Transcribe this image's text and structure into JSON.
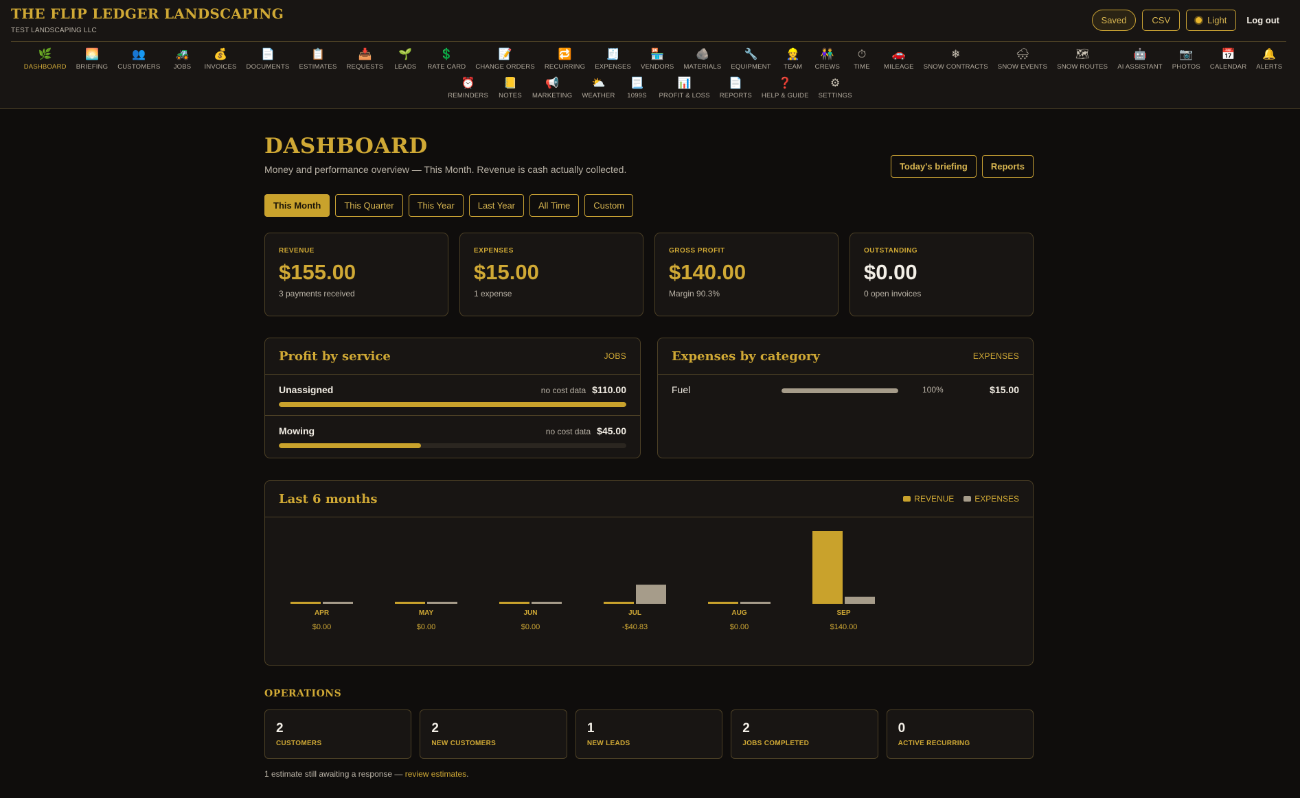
{
  "header": {
    "title": "THE FLIP LEDGER LANDSCAPING",
    "subtitle": "TEST LANDSCAPING LLC",
    "saved_label": "Saved",
    "csv_label": "CSV",
    "theme_label": "Light",
    "logout_label": "Log out"
  },
  "nav": {
    "row1": [
      {
        "label": "DASHBOARD",
        "icon": "🌿",
        "name": "dashboard"
      },
      {
        "label": "BRIEFING",
        "icon": "🌅",
        "name": "briefing"
      },
      {
        "label": "CUSTOMERS",
        "icon": "👥",
        "name": "customers"
      },
      {
        "label": "JOBS",
        "icon": "🚜",
        "name": "jobs"
      },
      {
        "label": "INVOICES",
        "icon": "💰",
        "name": "invoices"
      },
      {
        "label": "DOCUMENTS",
        "icon": "📄",
        "name": "documents"
      },
      {
        "label": "ESTIMATES",
        "icon": "📋",
        "name": "estimates"
      },
      {
        "label": "REQUESTS",
        "icon": "📥",
        "name": "requests"
      },
      {
        "label": "LEADS",
        "icon": "🌱",
        "name": "leads"
      },
      {
        "label": "RATE CARD",
        "icon": "💲",
        "name": "rate-card"
      },
      {
        "label": "CHANGE ORDERS",
        "icon": "📝",
        "name": "change-orders"
      },
      {
        "label": "RECURRING",
        "icon": "🔁",
        "name": "recurring"
      },
      {
        "label": "EXPENSES",
        "icon": "🧾",
        "name": "expenses"
      },
      {
        "label": "VENDORS",
        "icon": "🏪",
        "name": "vendors"
      },
      {
        "label": "MATERIALS",
        "icon": "🪨",
        "name": "materials"
      },
      {
        "label": "EQUIPMENT",
        "icon": "🔧",
        "name": "equipment"
      },
      {
        "label": "TEAM",
        "icon": "👷",
        "name": "team"
      },
      {
        "label": "CREWS",
        "icon": "👫",
        "name": "crews"
      },
      {
        "label": "TIME",
        "icon": "⏱",
        "name": "time"
      },
      {
        "label": "MILEAGE",
        "icon": "🚗",
        "name": "mileage"
      },
      {
        "label": "SNOW CONTRACTS",
        "icon": "❄",
        "name": "snow-contracts"
      },
      {
        "label": "SNOW EVENTS",
        "icon": "🌨",
        "name": "snow-events"
      },
      {
        "label": "SNOW ROUTES",
        "icon": "🗺",
        "name": "snow-routes"
      },
      {
        "label": "AI ASSISTANT",
        "icon": "🤖",
        "name": "ai-assistant"
      },
      {
        "label": "PHOTOS",
        "icon": "📷",
        "name": "photos"
      },
      {
        "label": "CALENDAR",
        "icon": "📅",
        "name": "calendar"
      },
      {
        "label": "ALERTS",
        "icon": "🔔",
        "name": "alerts"
      }
    ],
    "row2": [
      {
        "label": "REMINDERS",
        "icon": "⏰",
        "name": "reminders"
      },
      {
        "label": "NOTES",
        "icon": "📒",
        "name": "notes"
      },
      {
        "label": "MARKETING",
        "icon": "📢",
        "name": "marketing"
      },
      {
        "label": "WEATHER",
        "icon": "⛅",
        "name": "weather"
      },
      {
        "label": "1099S",
        "icon": "📃",
        "name": "1099s"
      },
      {
        "label": "PROFIT & LOSS",
        "icon": "📊",
        "name": "profit-loss"
      },
      {
        "label": "REPORTS",
        "icon": "📄",
        "name": "reports"
      },
      {
        "label": "HELP & GUIDE",
        "icon": "❓",
        "name": "help-guide"
      },
      {
        "label": "SETTINGS",
        "icon": "⚙",
        "name": "settings"
      }
    ]
  },
  "page": {
    "title": "DASHBOARD",
    "subtitle": "Money and performance overview — This Month. Revenue is cash actually collected.",
    "briefing_label": "Today's briefing",
    "reports_label": "Reports"
  },
  "periods": [
    "This Month",
    "This Quarter",
    "This Year",
    "Last Year",
    "All Time",
    "Custom"
  ],
  "active_period": 0,
  "kpis": [
    {
      "label": "REVENUE",
      "value": "$155.00",
      "sub": "3 payments received"
    },
    {
      "label": "EXPENSES",
      "value": "$15.00",
      "sub": "1 expense"
    },
    {
      "label": "GROSS PROFIT",
      "value": "$140.00",
      "sub": "Margin 90.3%"
    },
    {
      "label": "OUTSTANDING",
      "value": "$0.00",
      "sub": "0 open invoices"
    }
  ],
  "profit_by_service": {
    "title": "Profit by service",
    "tag": "JOBS",
    "rows": [
      {
        "name": "Unassigned",
        "note": "no cost data",
        "amount": "$110.00",
        "fraction": 1.0
      },
      {
        "name": "Mowing",
        "note": "no cost data",
        "amount": "$45.00",
        "fraction": 0.41
      }
    ]
  },
  "expenses_by_category": {
    "title": "Expenses by category",
    "tag": "EXPENSES",
    "rows": [
      {
        "name": "Fuel",
        "pct": "100%",
        "amount": "$15.00",
        "fraction": 1.0
      }
    ]
  },
  "chart_data": {
    "type": "bar",
    "title": "Last 6 months",
    "categories": [
      "APR",
      "MAY",
      "JUN",
      "JUL",
      "AUG",
      "SEP"
    ],
    "series": [
      {
        "name": "REVENUE",
        "color": "#c9a22c",
        "values": [
          0,
          0,
          0,
          0,
          0,
          155
        ]
      },
      {
        "name": "EXPENSES",
        "color": "#a69c8a",
        "values": [
          0,
          0,
          0,
          40.83,
          0,
          15
        ]
      }
    ],
    "net_labels": [
      "$0.00",
      "$0.00",
      "$0.00",
      "-$40.83",
      "$0.00",
      "$140.00"
    ],
    "ylim": [
      0,
      155
    ],
    "grid": false,
    "legend": "top-right"
  },
  "operations": {
    "title": "OPERATIONS",
    "items": [
      {
        "value": "2",
        "label": "CUSTOMERS"
      },
      {
        "value": "2",
        "label": "NEW CUSTOMERS"
      },
      {
        "value": "1",
        "label": "NEW LEADS"
      },
      {
        "value": "2",
        "label": "JOBS COMPLETED"
      },
      {
        "value": "0",
        "label": "ACTIVE RECURRING"
      }
    ]
  },
  "footnote": {
    "text": "1 estimate still awaiting a response — ",
    "link": "review estimates",
    "end": "."
  },
  "colors": {
    "accent": "#c9a22c",
    "expense": "#a69c8a",
    "background": "#0f0d0c"
  }
}
